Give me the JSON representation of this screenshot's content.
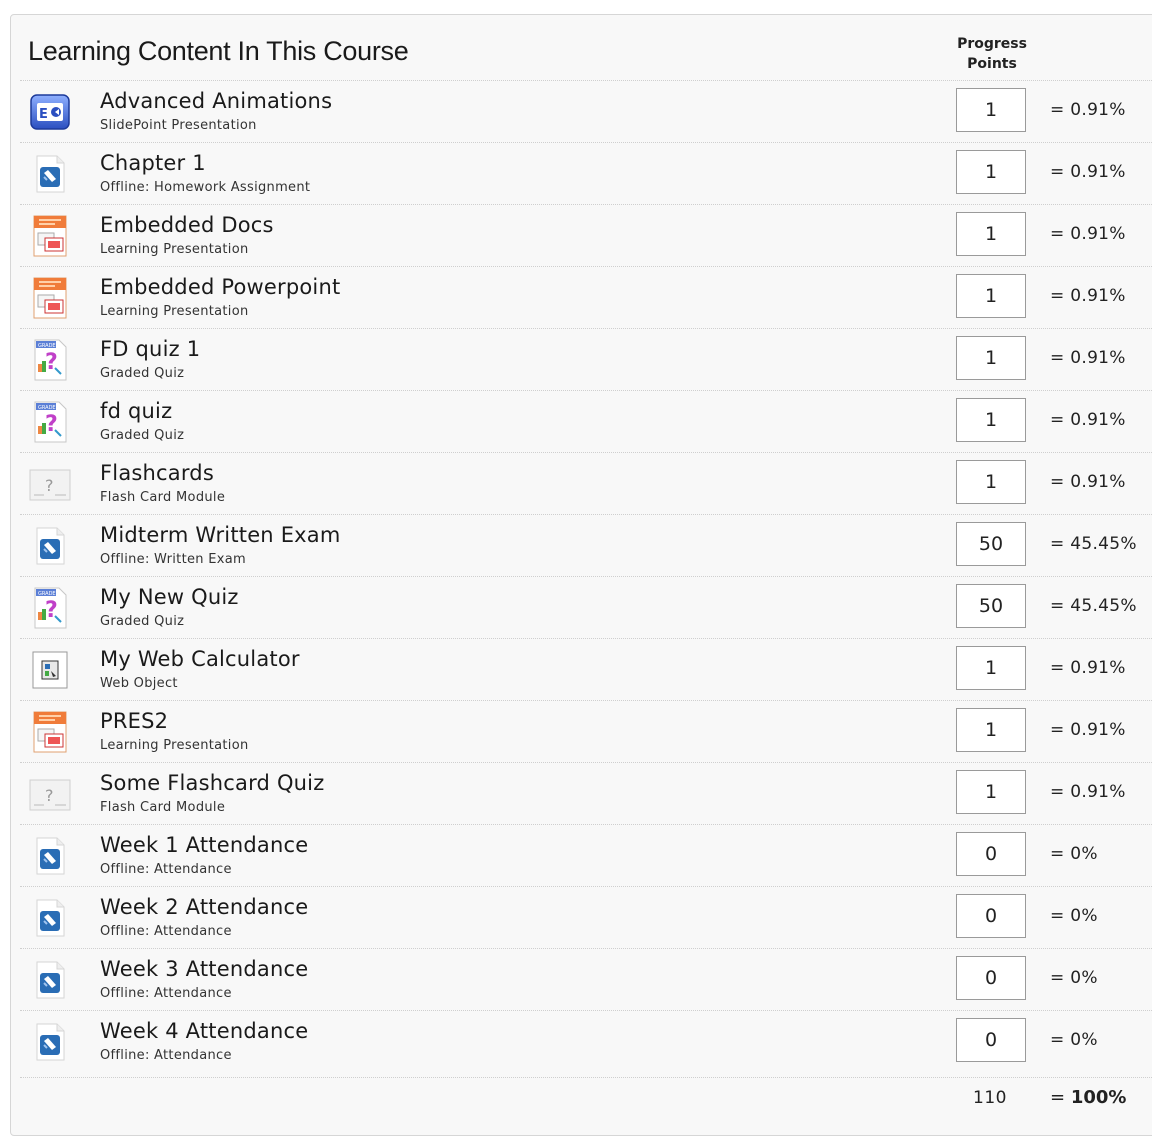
{
  "header": {
    "title": "Learning Content In This Course",
    "col_line1": "Progress",
    "col_line2": "Points"
  },
  "rows": [
    {
      "name": "Advanced Animations",
      "type": "SlidePoint Presentation",
      "points": "1",
      "pct": "= 0.91%",
      "icon": "slidepoint-icon"
    },
    {
      "name": "Chapter 1",
      "type": "Offline: Homework Assignment",
      "points": "1",
      "pct": "= 0.91%",
      "icon": "offline-icon"
    },
    {
      "name": "Embedded Docs",
      "type": "Learning Presentation",
      "points": "1",
      "pct": "= 0.91%",
      "icon": "presentation-icon"
    },
    {
      "name": "Embedded Powerpoint",
      "type": "Learning Presentation",
      "points": "1",
      "pct": "= 0.91%",
      "icon": "presentation-icon"
    },
    {
      "name": "FD quiz 1",
      "type": "Graded Quiz",
      "points": "1",
      "pct": "= 0.91%",
      "icon": "graded-quiz-icon"
    },
    {
      "name": "fd quiz",
      "type": "Graded Quiz",
      "points": "1",
      "pct": "= 0.91%",
      "icon": "graded-quiz-icon"
    },
    {
      "name": "Flashcards",
      "type": "Flash Card Module",
      "points": "1",
      "pct": "= 0.91%",
      "icon": "flashcard-icon"
    },
    {
      "name": "Midterm Written Exam",
      "type": "Offline: Written Exam",
      "points": "50",
      "pct": "= 45.45%",
      "icon": "offline-icon"
    },
    {
      "name": "My New Quiz",
      "type": "Graded Quiz",
      "points": "50",
      "pct": "= 45.45%",
      "icon": "graded-quiz-icon"
    },
    {
      "name": "My Web Calculator",
      "type": "Web Object",
      "points": "1",
      "pct": "= 0.91%",
      "icon": "web-object-icon"
    },
    {
      "name": "PRES2",
      "type": "Learning Presentation",
      "points": "1",
      "pct": "= 0.91%",
      "icon": "presentation-icon"
    },
    {
      "name": "Some Flashcard Quiz",
      "type": "Flash Card Module",
      "points": "1",
      "pct": "= 0.91%",
      "icon": "flashcard-icon"
    },
    {
      "name": "Week 1 Attendance",
      "type": "Offline: Attendance",
      "points": "0",
      "pct": "= 0%",
      "icon": "offline-icon"
    },
    {
      "name": "Week 2 Attendance",
      "type": "Offline: Attendance",
      "points": "0",
      "pct": "= 0%",
      "icon": "offline-icon"
    },
    {
      "name": "Week 3 Attendance",
      "type": "Offline: Attendance",
      "points": "0",
      "pct": "= 0%",
      "icon": "offline-icon"
    },
    {
      "name": "Week 4 Attendance",
      "type": "Offline: Attendance",
      "points": "0",
      "pct": "= 0%",
      "icon": "offline-icon"
    }
  ],
  "footer": {
    "total": "110",
    "eq": "=",
    "total_pct": "100%"
  },
  "colors": {
    "panel_bg": "#f8f8f8",
    "border": "#d6d6d6",
    "offline_blue": "#2a6db5",
    "presentation_orange": "#f07c3a",
    "slidepoint_blue": "#3a5fc4"
  }
}
